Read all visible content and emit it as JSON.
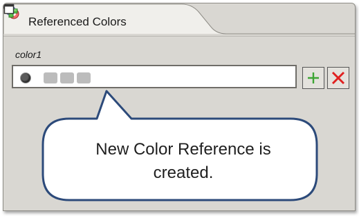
{
  "panel": {
    "tab_title": "Referenced Colors",
    "tab_icon": "referenced-colors-icon",
    "close_icon": "close-icon",
    "toolbar": {
      "add_icon": "add-plus-icon",
      "minimize_icon": "minimize-icon",
      "maximize_icon": "maximize-icon"
    }
  },
  "reference": {
    "label": "color1",
    "value_swatch_count": 3,
    "add_button_icon": "plus-icon",
    "remove_button_icon": "red-x-icon"
  },
  "callout": {
    "line1": "New Color Reference is",
    "line2": "created."
  },
  "colors": {
    "panel_bg": "#d9d7d2",
    "callout_border": "#2c4a7a",
    "add_green": "#3da534",
    "remove_red": "#e02020"
  }
}
